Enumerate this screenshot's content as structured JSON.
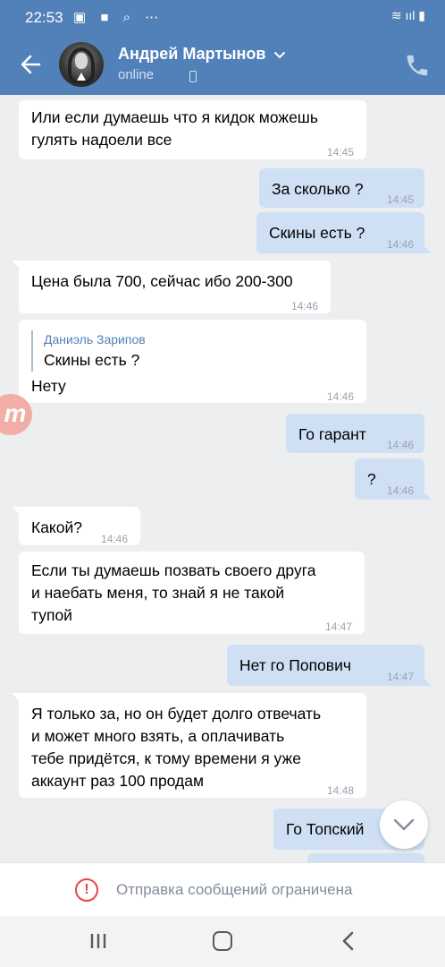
{
  "status_bar": {
    "time": "22:53",
    "icons": "▣ ■ ⌕ ⋯",
    "right": "≋ ııl ▮"
  },
  "header": {
    "name": "Андрей Мартынов",
    "status": "online",
    "icons": {
      "back": "arrow-left-icon",
      "dropdown": "chevron-down-icon",
      "call": "phone-icon"
    }
  },
  "messages": [
    {
      "dir": "in",
      "lines": [
        "Или если думаешь что я кидок можешь",
        "гулять надоели все"
      ],
      "time": "14:45"
    },
    {
      "dir": "out",
      "lines": [
        "За сколько ?"
      ],
      "time": "14:45"
    },
    {
      "dir": "out",
      "lines": [
        "Скины есть ?"
      ],
      "time": "14:46"
    },
    {
      "dir": "in",
      "lines": [
        "Цена была 700, сейчас ибо 200-300"
      ],
      "time": "14:46"
    },
    {
      "dir": "in",
      "quote": {
        "author": "Даниэль Зарипов",
        "text": "Скины есть ?"
      },
      "lines": [
        "Нету"
      ],
      "time": "14:46"
    },
    {
      "dir": "out",
      "lines": [
        "Го гарант"
      ],
      "time": "14:46"
    },
    {
      "dir": "out",
      "lines": [
        "?"
      ],
      "time": "14:46"
    },
    {
      "dir": "in",
      "lines": [
        "Какой?"
      ],
      "time": "14:46"
    },
    {
      "dir": "in",
      "lines": [
        "Если ты думаешь позвать своего друга",
        "и наебать меня, то знай я не такой",
        "тупой"
      ],
      "time": "14:47"
    },
    {
      "dir": "out",
      "lines": [
        "Нет го Попович"
      ],
      "time": "14:47"
    },
    {
      "dir": "in",
      "lines": [
        "Я только за, но он будет долго отвечать",
        "и может много взять, а оплачивать",
        "тебе придётся, к тому времени я уже",
        "аккаунт раз 100 продам"
      ],
      "time": "14:48"
    },
    {
      "dir": "out",
      "lines": [
        "Го Топский"
      ],
      "time": ""
    }
  ],
  "overlay_badge": "m",
  "restriction": {
    "text": "Отправка сообщений ограничена",
    "icon": "alert-circle-icon"
  },
  "colors": {
    "header": "#5181b8",
    "outgoing": "#cfe0f5",
    "incoming": "#ffffff",
    "background": "#edeef0",
    "alert": "#e64646"
  },
  "nav": {
    "recent": "recent-apps-icon",
    "home": "home-icon",
    "back": "back-icon"
  }
}
